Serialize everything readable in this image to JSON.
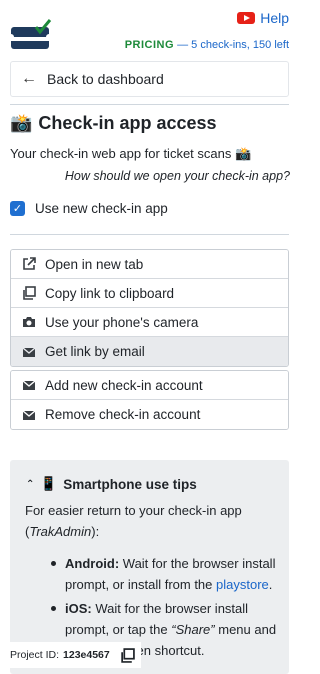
{
  "header": {
    "help_label": "Help",
    "pricing_label": "PRICING",
    "pricing_info": "— 5 check-ins, 150 left",
    "colors": {
      "brand_green": "#1d8a3a",
      "link_blue": "#1a66c9",
      "youtube_red": "#e62117"
    }
  },
  "nav": {
    "back_label": "Back to dashboard"
  },
  "page": {
    "title": "Check-in app access",
    "subtitle": "Your check-in web app for ticket scans",
    "question": "How should we open your check-in app?",
    "checkbox_label": "Use new check-in app"
  },
  "actions": [
    {
      "label": "Open in new tab",
      "icon": "external-link-icon"
    },
    {
      "label": "Copy link to clipboard",
      "icon": "copy-icon"
    },
    {
      "label": "Use your phone's camera",
      "icon": "camera-icon"
    },
    {
      "label": "Get link by email",
      "icon": "envelope-icon"
    }
  ],
  "account_actions": [
    {
      "label": "Add new check-in account",
      "icon": "envelope-icon"
    },
    {
      "label": "Remove check-in account",
      "icon": "envelope-icon"
    }
  ],
  "tips": {
    "title": "Smartphone use tips",
    "intro_prefix": "For easier return to your check-in app (",
    "intro_app": "TrakAdmin",
    "intro_suffix": "):",
    "android_label": "Android:",
    "android_text": "Wait for the browser install prompt, or install from the",
    "android_link": "playstore",
    "ios_label": "iOS:",
    "ios_text": "Wait for the browser install prompt, or tap the",
    "ios_share": "“Share”",
    "ios_text2": "menu and add the screen shortcut."
  },
  "footer": {
    "project_label": "Project ID:",
    "project_id": "123e4567"
  }
}
